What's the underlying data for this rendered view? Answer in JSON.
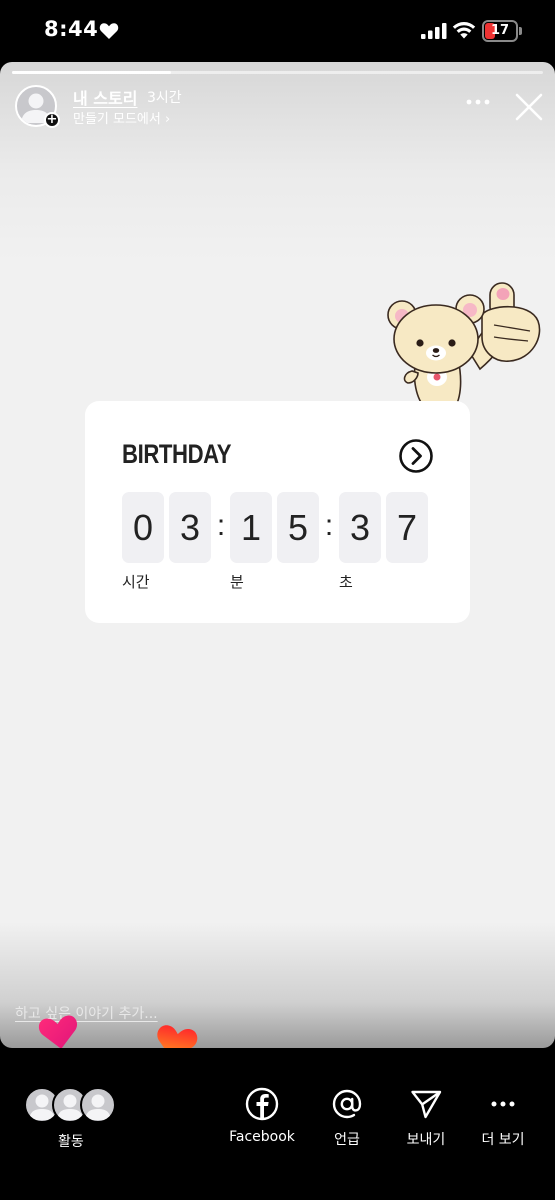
{
  "status_bar": {
    "time": "8:44",
    "battery": "17",
    "battery_color": "#ee3333"
  },
  "story": {
    "progress": 0.3,
    "username": "내 스토리",
    "time_ago": "3시간",
    "subtitle": "만들기 모드에서 ›",
    "add_story_prompt": "하고 싶은 이야기 추가..."
  },
  "countdown": {
    "title": "BIRTHDAY",
    "digits": [
      "0",
      "3",
      "1",
      "5",
      "3",
      "7"
    ],
    "separator": ":",
    "units": {
      "hours": "시간",
      "minutes": "분",
      "seconds": "초"
    }
  },
  "bottom_bar": {
    "activity_label": "활동",
    "actions": [
      {
        "label": "Facebook",
        "icon": "facebook-icon"
      },
      {
        "label": "언급",
        "icon": "mention-icon"
      },
      {
        "label": "보내기",
        "icon": "send-icon"
      },
      {
        "label": "더 보기",
        "icon": "more-icon"
      }
    ]
  },
  "colors": {
    "card_bg": "#ffffff",
    "digit_bg": "#f0f0f3",
    "heart_pink": "#ff1f6e",
    "heart_orange": "#ff5a1f"
  }
}
